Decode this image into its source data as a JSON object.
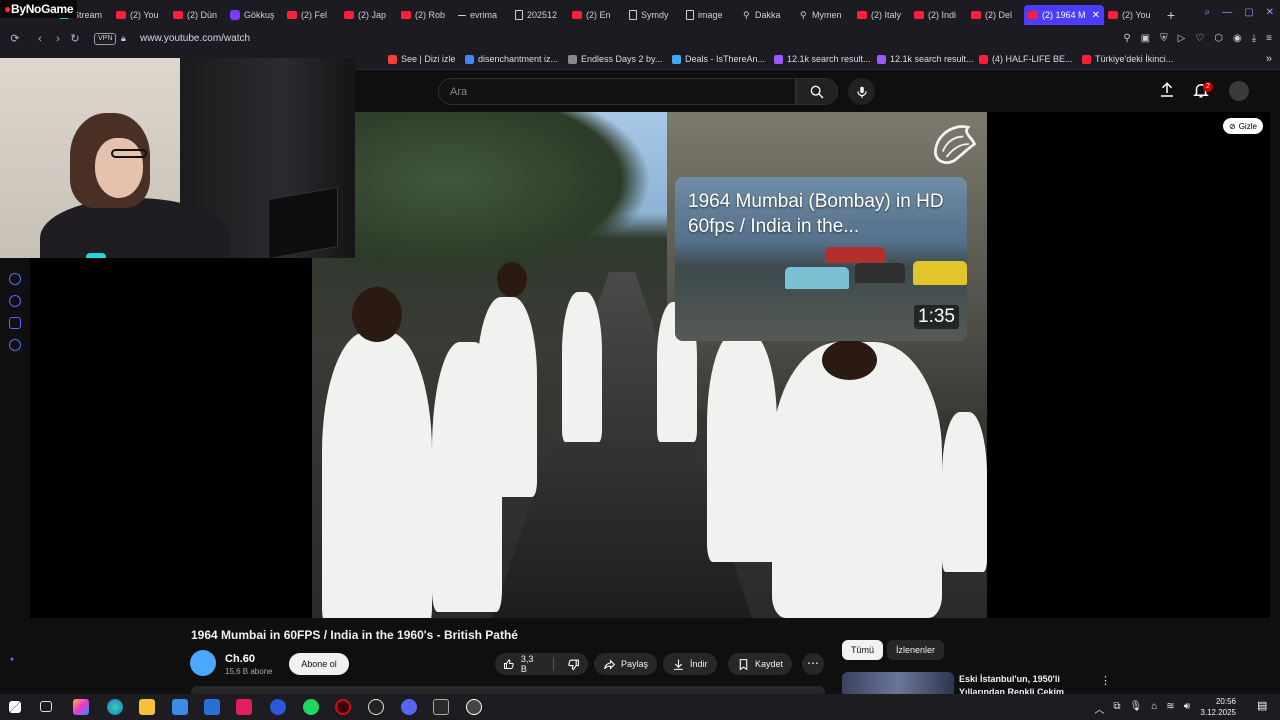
{
  "overlay": {
    "brand_text": "ByNoGame"
  },
  "browser": {
    "tabs": [
      {
        "label": "Stream",
        "icon": "ticon-green"
      },
      {
        "label": "(2) You",
        "icon": "youtube-icon"
      },
      {
        "label": "(2) Dün",
        "icon": "youtube-icon"
      },
      {
        "label": "Gökkuş",
        "icon": "s-icon"
      },
      {
        "label": "(2) Fel",
        "icon": "youtube-icon"
      },
      {
        "label": "(2) Jap",
        "icon": "youtube-icon"
      },
      {
        "label": "(2) Rob",
        "icon": "youtube-icon"
      },
      {
        "label": "evrima",
        "icon": "dash-icon"
      },
      {
        "label": "202512",
        "icon": "doc-icon"
      },
      {
        "label": "(2) En",
        "icon": "youtube-icon"
      },
      {
        "label": "Symdy",
        "icon": "doc-icon"
      },
      {
        "label": "image",
        "icon": "doc-icon"
      },
      {
        "label": "Dakka",
        "icon": "map-pin-icon"
      },
      {
        "label": "Mymen",
        "icon": "map-pin-icon"
      },
      {
        "label": "(2) Italy",
        "icon": "youtube-icon"
      },
      {
        "label": "(2) Indi",
        "icon": "youtube-icon"
      },
      {
        "label": "(2) Del",
        "icon": "youtube-icon"
      },
      {
        "label": "(2) 1964 M",
        "icon": "youtube-icon",
        "active": true
      },
      {
        "label": "(2) You",
        "icon": "youtube-icon"
      }
    ],
    "address": {
      "vpn_label": "VPN",
      "url": "www.youtube.com/watch"
    },
    "bookmarks": [
      {
        "label": "See | Dizi izle",
        "color": "#ff3b3b"
      },
      {
        "label": "disenchantment iz...",
        "color": "#4285f4"
      },
      {
        "label": "Endless Days 2 by...",
        "color": "#888888"
      },
      {
        "label": "Deals - IsThereAn...",
        "color": "#3fa9f5"
      },
      {
        "label": "12.1k search result...",
        "color": "#9b59ff"
      },
      {
        "label": "12.1k search result...",
        "color": "#9b59ff"
      },
      {
        "label": "(4) HALF-LIFE BE...",
        "color": "#ff1f3d"
      },
      {
        "label": "Türkiye'deki İkinci...",
        "color": "#ff1f3d"
      }
    ]
  },
  "youtube": {
    "search": {
      "placeholder": "Ara"
    },
    "notifications_count": "2",
    "player": {
      "hide_label": "Gizle",
      "preview": {
        "title": "1964 Mumbai (Bombay) in HD 60fps / India in the...",
        "duration": "1:35"
      }
    },
    "video": {
      "title": "1964 Mumbai in 60FPS / India in the 1960's - British Pathé",
      "channel": "Ch.60",
      "subscribers": "15,6 B abone",
      "subscribe_label": "Abone ol",
      "likes": "3,3 B",
      "share_label": "Paylaş",
      "download_label": "İndir",
      "save_label": "Kaydet"
    },
    "sidebar": {
      "chips": [
        "Tümü",
        "İzlenenler"
      ],
      "recommendation_title": "Eski İstanbul'un, 1950'li Yıllarından Renkli Çekim"
    }
  },
  "taskbar": {
    "time": "20:56",
    "date": "3.12.2025"
  }
}
